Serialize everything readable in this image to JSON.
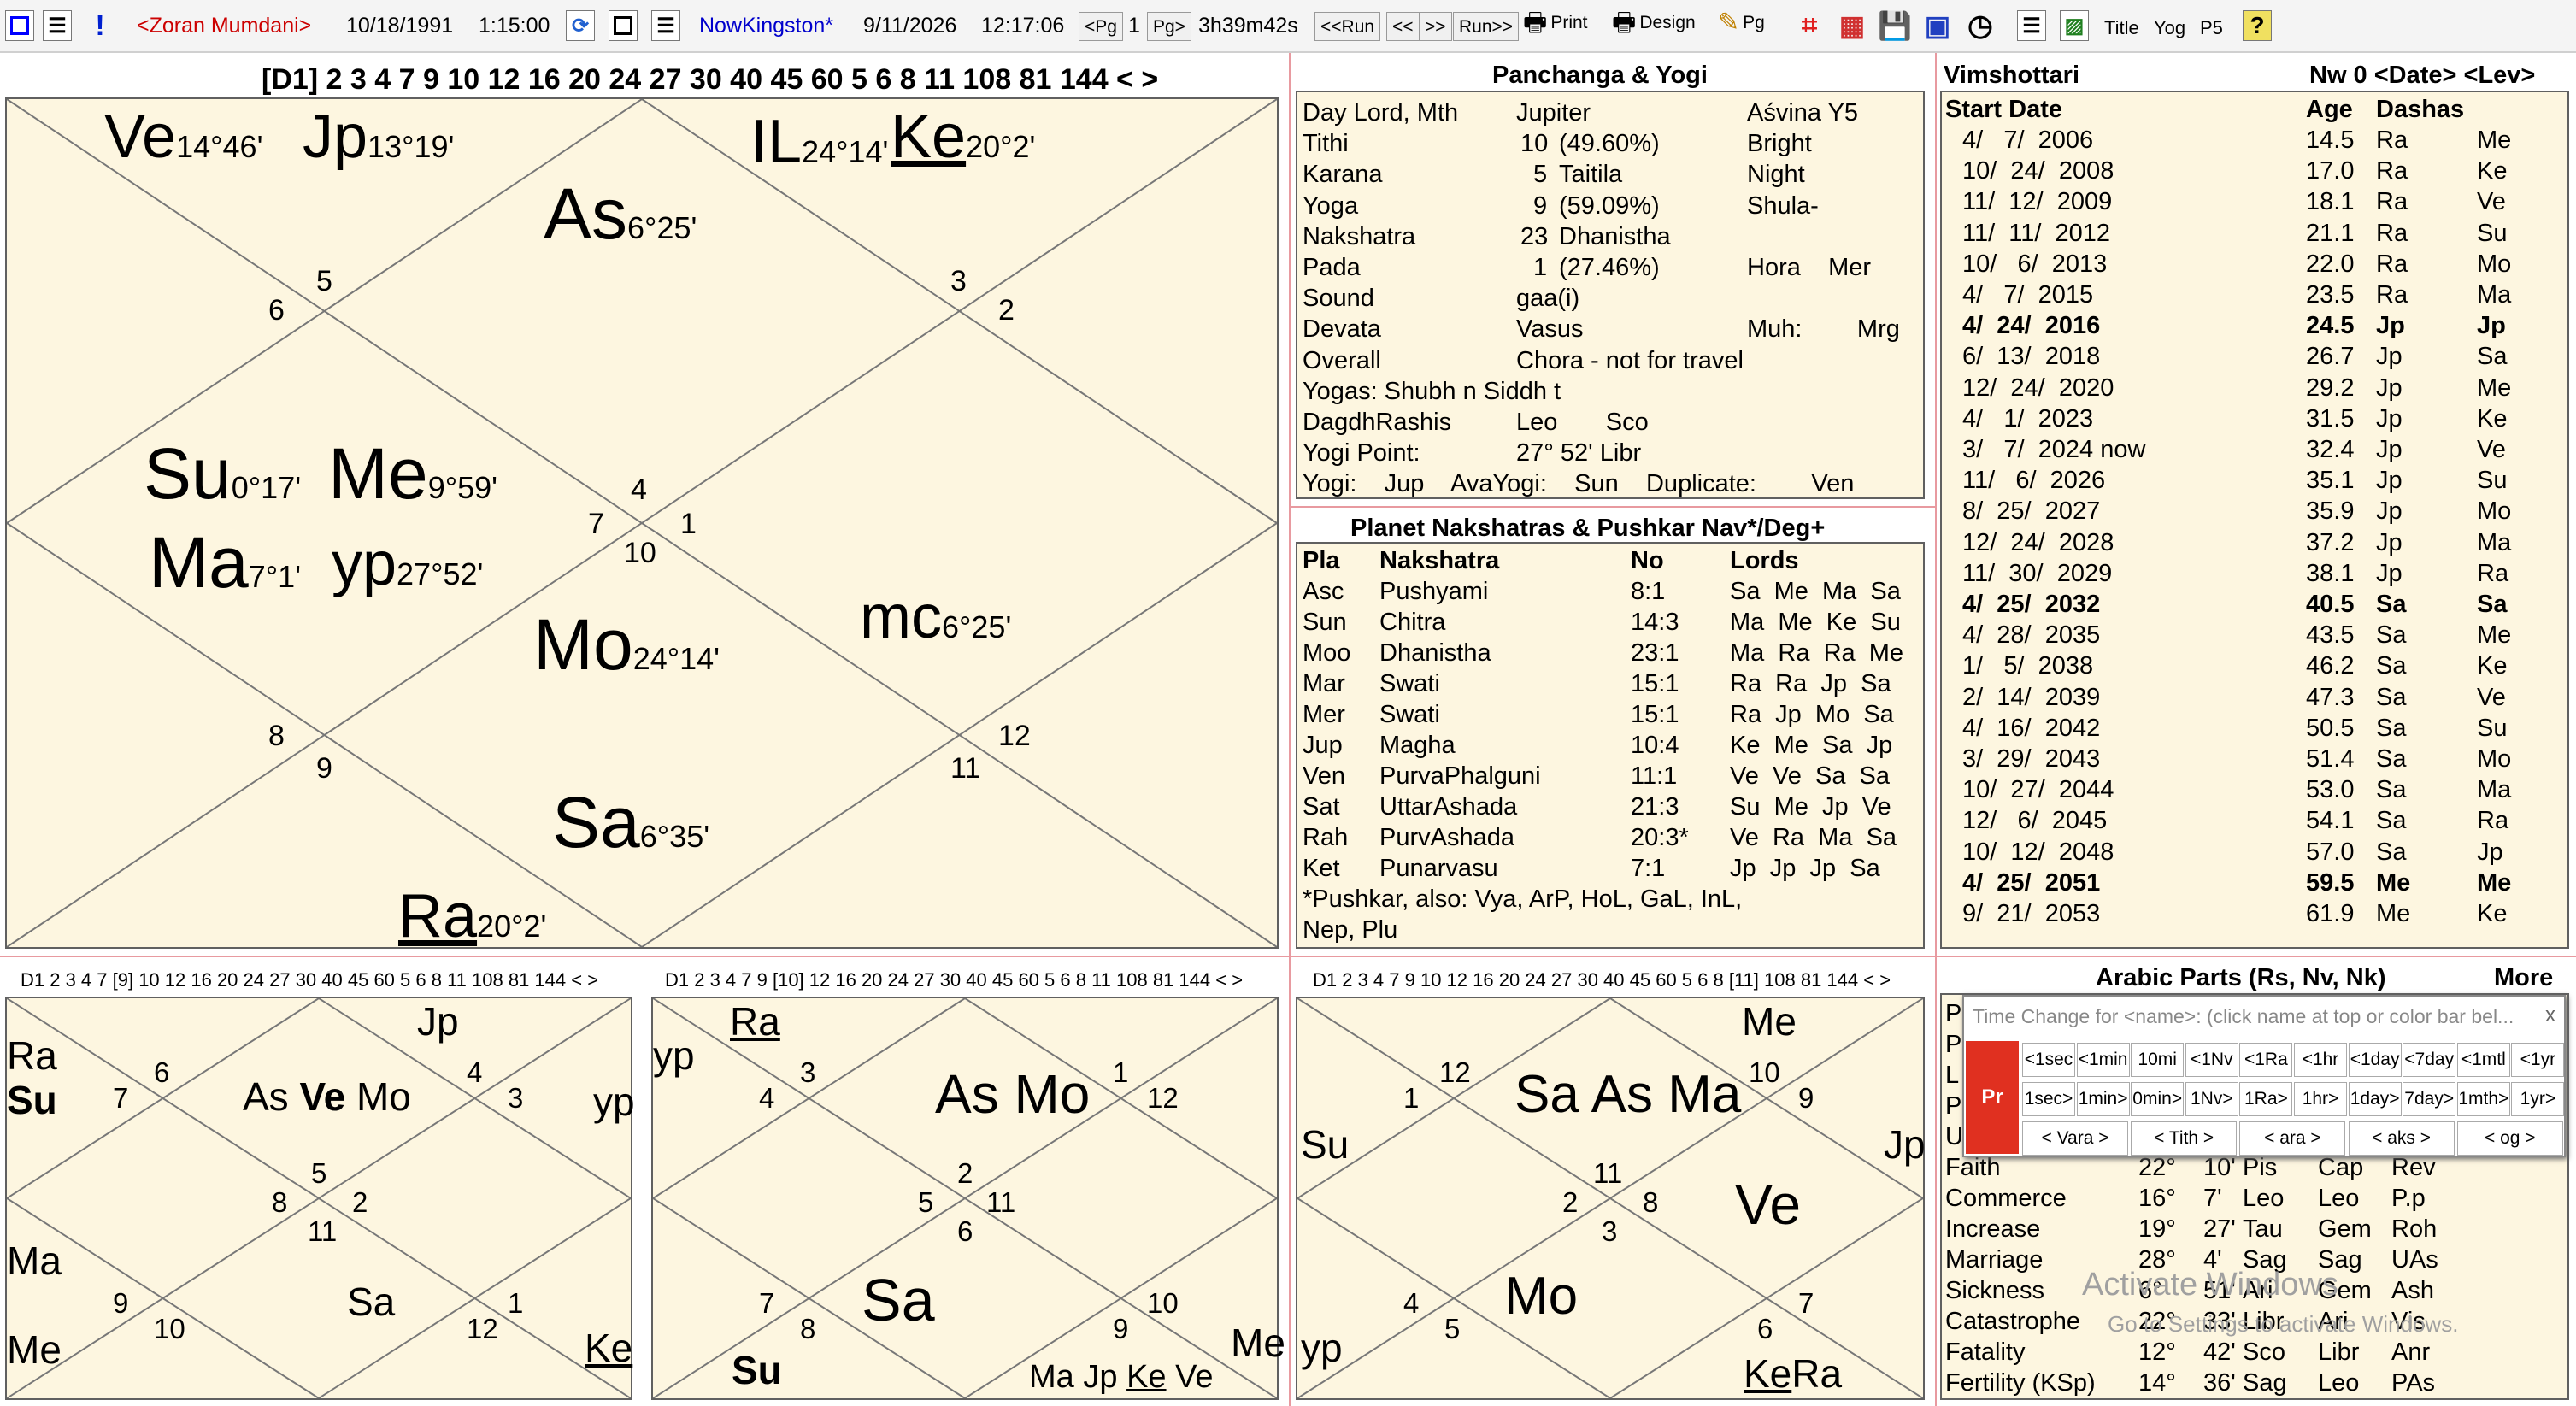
{
  "toolbar": {
    "person": "<Zoran Mumdani>",
    "birth_date": "10/18/1991",
    "birth_time": "1:15:00",
    "now_label": "NowKingston*",
    "now_date": "9/11/2026",
    "now_time": "12:17:06",
    "pg_prev": "<Pg",
    "pg_num": "1",
    "pg_next": "Pg>",
    "elapsed": "3h39m42s",
    "run_back": "<<Run",
    "step_back": "<<",
    "step_fwd": ">>",
    "run_fwd": "Run>>",
    "print": "Print",
    "design": "Design",
    "pg": "Pg",
    "title": "Title",
    "yog": "Yog",
    "p5": "P5",
    "help": "?"
  },
  "main_chart": {
    "vargas": "[D1] 2 3 4 7 9 10 12 16 20 24 27 30 40 45 60 5 6 8 11 108 81 144 < >",
    "houses": [
      "1",
      "2",
      "3",
      "4",
      "5",
      "6",
      "7",
      "8",
      "9",
      "10",
      "11",
      "12"
    ],
    "ve": "Ve",
    "ve_deg": "14°46'",
    "jp": "Jp",
    "jp_deg": "13°19'",
    "il": "IL",
    "il_deg": "24°14'",
    "ke": "Ke",
    "ke_deg": "20°2'",
    "as": "As",
    "as_deg": "6°25'",
    "su": "Su",
    "su_deg": "0°17'",
    "me": "Me",
    "me_deg": "9°59'",
    "ma": "Ma",
    "ma_deg": "7°1'",
    "yp": "yp",
    "yp_deg": "27°52'",
    "mo": "Mo",
    "mo_deg": "24°14'",
    "mc": "mc",
    "mc_deg": "6°25'",
    "sa": "Sa",
    "sa_deg": "6°35'",
    "ra": "Ra",
    "ra_deg": "20°2'"
  },
  "panchanga": {
    "title": "Panchanga & Yogi",
    "rows": [
      [
        "Day Lord, Mth",
        "",
        "Jupiter",
        "Aśvina Y5"
      ],
      [
        "Tithi",
        "10",
        "(49.60%)",
        "Bright"
      ],
      [
        "Karana",
        "5",
        "Taitila",
        "Night"
      ],
      [
        "Yoga",
        "9",
        "(59.09%)",
        "Shula-"
      ],
      [
        "Nakshatra",
        "23",
        "Dhanistha",
        ""
      ],
      [
        "Pada",
        "1",
        "(27.46%)",
        "Hora    Mer"
      ],
      [
        "Sound",
        "",
        "gaa(i)",
        ""
      ],
      [
        "Devata",
        "",
        "Vasus",
        "Muh:        Mrg"
      ],
      [
        "Overall",
        "",
        "Chora - not for travel",
        ""
      ],
      [
        "Yogas: Shubh n Siddh t",
        "",
        "",
        ""
      ],
      [
        "DagdhRashis",
        "",
        "Leo       Sco",
        ""
      ],
      [
        "Yogi Point:",
        "",
        "27° 52' Libr",
        ""
      ],
      [
        "Yogi:    Jup    AvaYogi:    Sun    Duplicate:        Ven",
        "",
        "",
        ""
      ]
    ]
  },
  "nakshatras": {
    "title": "Planet Nakshatras & Pushkar Nav*/Deg+",
    "headers": [
      "Pla",
      "Nakshatra",
      "No",
      "Lords"
    ],
    "rows": [
      [
        "Asc",
        "Pushyami",
        "8:1",
        "Sa  Me  Ma  Sa"
      ],
      [
        "Sun",
        "Chitra",
        "14:3",
        "Ma  Me  Ke  Su"
      ],
      [
        "Moo",
        "Dhanistha",
        "23:1",
        "Ma  Ra  Ra  Me"
      ],
      [
        "Mar",
        "Swati",
        "15:1",
        "Ra  Ra  Jp  Sa"
      ],
      [
        "Mer",
        "Swati",
        "15:1",
        "Ra  Jp  Mo  Sa"
      ],
      [
        "Jup",
        "Magha",
        "10:4",
        "Ke  Me  Sa  Jp"
      ],
      [
        "Ven",
        "PurvaPhalguni",
        "11:1",
        "Ve  Ve  Sa  Sa"
      ],
      [
        "Sat",
        "UttarAshada",
        "21:3",
        "Su  Me  Jp  Ve"
      ],
      [
        "Rah",
        "PurvAshada",
        "20:3*",
        "Ve  Ra  Ma  Sa"
      ],
      [
        "Ket",
        "Punarvasu",
        "7:1",
        "Jp  Jp  Jp  Sa"
      ]
    ],
    "pushkar1": "*Pushkar, also:     Vya,    ArP,    HoL,   GaL,   InL,",
    "pushkar2": "Nep,   Plu"
  },
  "vimshottari": {
    "title": "Vimshottari",
    "nav": "Nw 0 <Date> <Lev>",
    "headers": [
      "Start Date",
      "Age",
      "Dashas"
    ],
    "rows": [
      [
        "4/   7/  2006",
        "14.5",
        "Ra",
        "Me",
        false
      ],
      [
        "10/  24/  2008",
        "17.0",
        "Ra",
        "Ke",
        false
      ],
      [
        "11/  12/  2009",
        "18.1",
        "Ra",
        "Ve",
        false
      ],
      [
        "11/  11/  2012",
        "21.1",
        "Ra",
        "Su",
        false
      ],
      [
        "10/   6/  2013",
        "22.0",
        "Ra",
        "Mo",
        false
      ],
      [
        "4/   7/  2015",
        "23.5",
        "Ra",
        "Ma",
        false
      ],
      [
        "4/  24/  2016",
        "24.5",
        "Jp",
        "Jp",
        true
      ],
      [
        "6/  13/  2018",
        "26.7",
        "Jp",
        "Sa",
        false
      ],
      [
        "12/  24/  2020",
        "29.2",
        "Jp",
        "Me",
        false
      ],
      [
        "4/   1/  2023",
        "31.5",
        "Jp",
        "Ke",
        false
      ],
      [
        "3/   7/  2024 now",
        "32.4",
        "Jp",
        "Ve",
        false
      ],
      [
        "11/   6/  2026",
        "35.1",
        "Jp",
        "Su",
        false
      ],
      [
        "8/  25/  2027",
        "35.9",
        "Jp",
        "Mo",
        false
      ],
      [
        "12/  24/  2028",
        "37.2",
        "Jp",
        "Ma",
        false
      ],
      [
        "11/  30/  2029",
        "38.1",
        "Jp",
        "Ra",
        false
      ],
      [
        "4/  25/  2032",
        "40.5",
        "Sa",
        "Sa",
        true
      ],
      [
        "4/  28/  2035",
        "43.5",
        "Sa",
        "Me",
        false
      ],
      [
        "1/   5/  2038",
        "46.2",
        "Sa",
        "Ke",
        false
      ],
      [
        "2/  14/  2039",
        "47.3",
        "Sa",
        "Ve",
        false
      ],
      [
        "4/  16/  2042",
        "50.5",
        "Sa",
        "Su",
        false
      ],
      [
        "3/  29/  2043",
        "51.4",
        "Sa",
        "Mo",
        false
      ],
      [
        "10/  27/  2044",
        "53.0",
        "Sa",
        "Ma",
        false
      ],
      [
        "12/   6/  2045",
        "54.1",
        "Sa",
        "Ra",
        false
      ],
      [
        "10/  12/  2048",
        "57.0",
        "Sa",
        "Jp",
        false
      ],
      [
        "4/  25/  2051",
        "59.5",
        "Me",
        "Me",
        true
      ],
      [
        "9/  21/  2053",
        "61.9",
        "Me",
        "Ke",
        false
      ]
    ]
  },
  "chart_d9": {
    "vargas": "D1 2 3 4 7 [9] 10 12 16 20 24 27 30 40 45 60 5 6 8 11 108 81 144 < >",
    "h": [
      "5",
      "2",
      "3",
      "4",
      "6",
      "7",
      "8",
      "9",
      "10",
      "11",
      "12",
      "1"
    ],
    "ra": "Ra",
    "su": "Su",
    "jp": "Jp",
    "as": "As",
    "ve": "Ve",
    "mo": "Mo",
    "yp": "yp",
    "ma": "Ma",
    "me": "Me",
    "sa": "Sa",
    "ke": "Ke"
  },
  "chart_d10": {
    "vargas": "D1 2 3 4 7 9 [10] 12 16 20 24 27 30 40 45 60 5 6 8 11 108 81 144 < >",
    "h": [
      "2",
      "11",
      "12",
      "1",
      "3",
      "4",
      "5",
      "6",
      "7",
      "8",
      "9",
      "10"
    ],
    "yp": "yp",
    "ra": "Ra",
    "as": "As",
    "mo": "Mo",
    "sa": "Sa",
    "su": "Su",
    "me": "Me",
    "ma": "Ma",
    "jp": "Jp",
    "ke": "Ke",
    "ve": "Ve"
  },
  "chart_d11": {
    "vargas": "D1 2 3 4 7 9 10 12 16 20 24 27 30 40 45 60 5 6 8 [11] 108 81 144 < >",
    "h": [
      "11",
      "8",
      "9",
      "10",
      "12",
      "1",
      "2",
      "3",
      "4",
      "5",
      "6",
      "7"
    ],
    "me": "Me",
    "sa": "Sa",
    "as": "As",
    "ma": "Ma",
    "su": "Su",
    "jp": "Jp",
    "ve": "Ve",
    "mo": "Mo",
    "yp": "yp",
    "ke": "Ke",
    "ra": "Ra"
  },
  "arabic": {
    "title": "Arabic Parts (Rs, Nv, Nk)",
    "more": "More",
    "left_letters": [
      "P",
      "P",
      "L",
      "P",
      "U"
    ],
    "rows": [
      [
        "Faith",
        "22°",
        "10'",
        "Pis",
        "Cap",
        "Rev"
      ],
      [
        "Commerce",
        "16°",
        "7'",
        "Leo",
        "Leo",
        "P.p"
      ],
      [
        "Increase",
        "19°",
        "27'",
        "Tau",
        "Gem",
        "Roh"
      ],
      [
        "Marriage",
        "28°",
        "4'",
        "Sag",
        "Sag",
        "UAs"
      ],
      [
        "Sickness",
        "6°",
        "51'",
        "Ari",
        "Gem",
        "Ash"
      ],
      [
        "Catastrophe",
        "22°",
        "33'",
        "Libr",
        "Ari",
        "Vis"
      ],
      [
        "Fatality",
        "12°",
        "42'",
        "Sco",
        "Libr",
        "Anr"
      ],
      [
        "Fertility (KSp)",
        "14°",
        "36'",
        "Sag",
        "Leo",
        "PAs"
      ]
    ]
  },
  "popup": {
    "title": "Time Change for <name>: (click name at top or color bar bel...",
    "close": "x",
    "pr": "Pr",
    "row1": [
      "<1sec",
      "<1min",
      "10mi",
      "<1Nv",
      "<1Ra",
      "<1hr",
      "<1day",
      "<7day",
      "<1mtl",
      "<1yr"
    ],
    "row2": [
      "1sec>",
      "1min>",
      "0min>",
      "1Nv>",
      "1Ra>",
      "1hr>",
      "1day>",
      "7day>",
      "1mth>",
      "1yr>"
    ],
    "row3": [
      "<  Vara  >",
      "<  Tith  >",
      "<  ara  >",
      "<  aks  >",
      "<  og  >"
    ]
  },
  "watermark": {
    "line1": "Activate Windows",
    "line2": "Go to Settings to activate Windows."
  },
  "colors": {
    "chart_bg": "#fdf6e0",
    "person": "#cc0000",
    "now": "#0000cc",
    "divider": "#e89aa0",
    "pr_btn": "#e03020"
  }
}
